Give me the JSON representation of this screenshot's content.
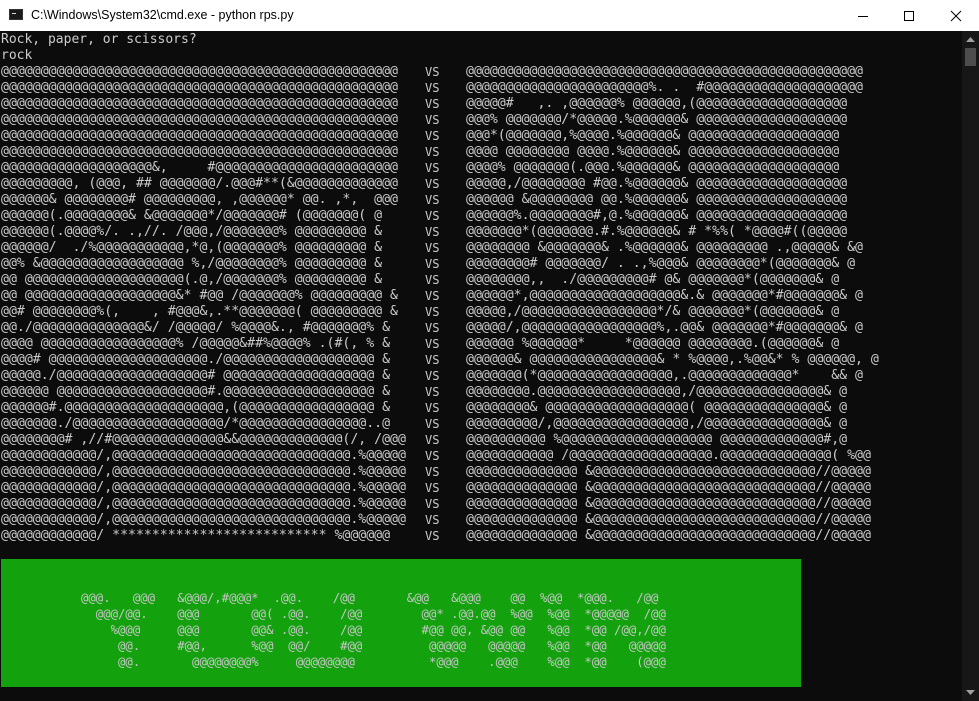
{
  "window": {
    "title": "C:\\Windows\\System32\\cmd.exe - python  rps.py",
    "app_icon": "cmd-icon",
    "controls": [
      "minimize-icon",
      "maximize-icon",
      "close-icon"
    ]
  },
  "console": {
    "prompt": "Rock, paper, or scissors?",
    "input": "rock",
    "vs_label": "VS",
    "left_art": [
      "@@@@@@@@@@@@@@@@@@@@@@@@@@@@@@@@@@@@@@@@@@@@@@@@@@",
      "@@@@@@@@@@@@@@@@@@@@@@@@@@@@@@@@@@@@@@@@@@@@@@@@@@",
      "@@@@@@@@@@@@@@@@@@@@@@@@@@@@@@@@@@@@@@@@@@@@@@@@@@",
      "@@@@@@@@@@@@@@@@@@@@@@@@@@@@@@@@@@@@@@@@@@@@@@@@@@",
      "@@@@@@@@@@@@@@@@@@@@@@@@@@@@@@@@@@@@@@@@@@@@@@@@@@",
      "@@@@@@@@@@@@@@@@@@@@@@@@@@@@@@@@@@@@@@@@@@@@@@@@@@",
      "@@@@@@@@@@@@@@@@@@@&,     #@@@@@@@@@@@@@@@@@@@@@@@",
      "@@@@@@@@@, (@@@, ## @@@@@@@/.@@@#**(&@@@@@@@@@@@@@",
      "@@@@@@& @@@@@@@@# @@@@@@@@@, ,@@@@@@* @@. ,*,  @@@",
      "@@@@@@(.@@@@@@@@& &@@@@@@@*/@@@@@@@# (@@@@@@@( @",
      "@@@@@@(.@@@@%/. .,//. /@@@,/@@@@@@@% @@@@@@@@@ &",
      "@@@@@@/  ./%@@@@@@@@@@@,*@,(@@@@@@@% @@@@@@@@@ &",
      "@@% &@@@@@@@@@@@@@@@@@@ %,/@@@@@@@@% @@@@@@@@@ &",
      "@@ @@@@@@@@@@@@@@@@@@@@(.@,/@@@@@@@% @@@@@@@@@ &",
      "@@ @@@@@@@@@@@@@@@@@@@&* #@@ /@@@@@@@% @@@@@@@@@ &",
      "@@# @@@@@@@@%(,    , #@@@&,.**@@@@@@@( @@@@@@@@@ &",
      "@@./@@@@@@@@@@@@@@&/ /@@@@@/ %@@@@&., #@@@@@@@% &",
      "@@@@ @@@@@@@@@@@@@@@@@% /@@@@@&##%@@@@% .(#(, % &",
      "@@@@# @@@@@@@@@@@@@@@@@@@@./@@@@@@@@@@@@@@@@@@@ &",
      "@@@@@./@@@@@@@@@@@@@@@@@@@# @@@@@@@@@@@@@@@@@@@ &",
      "@@@@@@ @@@@@@@@@@@@@@@@@@@#.@@@@@@@@@@@@@@@@@@@ &",
      "@@@@@@#.@@@@@@@@@@@@@@@@@@@@,(@@@@@@@@@@@@@@@@@ &",
      "@@@@@@@./@@@@@@@@@@@@@@@@@@@/*@@@@@@@@@@@@@@@@..@",
      "@@@@@@@@# ,//#@@@@@@@@@@@@@@&&@@@@@@@@@@@@@(/, /@@@",
      "@@@@@@@@@@@@/,@@@@@@@@@@@@@@@@@@@@@@@@@@@@@@.%@@@@@",
      "@@@@@@@@@@@@/,@@@@@@@@@@@@@@@@@@@@@@@@@@@@@@.%@@@@@",
      "@@@@@@@@@@@@/,@@@@@@@@@@@@@@@@@@@@@@@@@@@@@@.%@@@@@",
      "@@@@@@@@@@@@/,@@@@@@@@@@@@@@@@@@@@@@@@@@@@@@.%@@@@@",
      "@@@@@@@@@@@@/,@@@@@@@@@@@@@@@@@@@@@@@@@@@@@@.%@@@@@",
      "@@@@@@@@@@@@/ *************************** %@@@@@@"
    ],
    "right_art": [
      "@@@@@@@@@@@@@@@@@@@@@@@@@@@@@@@@@@@@@@@@@@@@@@@@@@",
      "@@@@@@@@@@@@@@@@@@@@@@@%. .  #@@@@@@@@@@@@@@@@@@@@",
      "@@@@@#   ,. ,@@@@@@% @@@@@@,(@@@@@@@@@@@@@@@@@@@",
      "@@@% @@@@@@@/*@@@@@.%@@@@@@& @@@@@@@@@@@@@@@@@@@",
      "@@@*(@@@@@@@,%@@@@.%@@@@@@& @@@@@@@@@@@@@@@@@@@",
      "@@@@ @@@@@@@@ @@@@.%@@@@@@& @@@@@@@@@@@@@@@@@@@",
      "@@@@% @@@@@@@(.@@@.%@@@@@@& @@@@@@@@@@@@@@@@@@@",
      "@@@@@,/@@@@@@@@ #@@.%@@@@@@& @@@@@@@@@@@@@@@@@@@",
      "@@@@@@ &@@@@@@@@ @@.%@@@@@@& @@@@@@@@@@@@@@@@@@@",
      "@@@@@@%.@@@@@@@@#,@.%@@@@@@& @@@@@@@@@@@@@@@@@@@",
      "@@@@@@@*(@@@@@@@.#.%@@@@@@& # *%%( *@@@@#((@@@@@",
      "@@@@@@@@ &@@@@@@@& .%@@@@@@& @@@@@@@@@ .,@@@@@& &@",
      "@@@@@@@@# @@@@@@@/ . .,%@@@& @@@@@@@@*(@@@@@@@& @",
      "@@@@@@@@,,  ./@@@@@@@@@# @& @@@@@@@*(@@@@@@@& @",
      "@@@@@@*,@@@@@@@@@@@@@@@@@@@&.& @@@@@@@*#@@@@@@@& @",
      "@@@@@,/@@@@@@@@@@@@@@@@@*/& @@@@@@@*(@@@@@@@& @",
      "@@@@@/,@@@@@@@@@@@@@@@@@%,.@@& @@@@@@@*#@@@@@@@& @",
      "@@@@@@ %@@@@@@*     *@@@@@@ @@@@@@@@.(@@@@@@& @",
      "@@@@@@& @@@@@@@@@@@@@@@@& * %@@@@,.%@@&* % @@@@@@, @",
      "@@@@@@@(*@@@@@@@@@@@@@@@@@,.@@@@@@@@@@@@@*    && @",
      "@@@@@@@@.@@@@@@@@@@@@@@@@@@,/@@@@@@@@@@@@@@@@& @",
      "@@@@@@@@& @@@@@@@@@@@@@@@@@@( @@@@@@@@@@@@@@@& @",
      "@@@@@@@@@/,@@@@@@@@@@@@@@@@@,/@@@@@@@@@@@@@@@& @",
      "@@@@@@@@@@ %@@@@@@@@@@@@@@@@@@@ @@@@@@@@@@@@@#,@",
      "@@@@@@@@@@@ /@@@@@@@@@@@@@@@@@@.@@@@@@@@@@@@@@( %@@",
      "@@@@@@@@@@@@@@ &@@@@@@@@@@@@@@@@@@@@@@@@@@@@//@@@@@",
      "@@@@@@@@@@@@@@ &@@@@@@@@@@@@@@@@@@@@@@@@@@@@//@@@@@",
      "@@@@@@@@@@@@@@ &@@@@@@@@@@@@@@@@@@@@@@@@@@@@//@@@@@",
      "@@@@@@@@@@@@@@ &@@@@@@@@@@@@@@@@@@@@@@@@@@@@//@@@@@",
      "@@@@@@@@@@@@@@ &@@@@@@@@@@@@@@@@@@@@@@@@@@@@//@@@@@"
    ],
    "banner_color": "#13a10e",
    "banner_lines": [
      "@@@.   @@@   &@@@/,#@@@*  .@@.    /@@       &@@   &@@@    @@  %@@  *@@@.   /@@",
      "  @@@/@@.    @@@       @@( .@@.    /@@        @@* .@@.@@  %@@  %@@  *@@@@@  /@@",
      "    %@@@     @@@       @@& .@@.    /@@        #@@ @@, &@@ @@   %@@  *@@ /@@,/@@",
      "     @@.     #@@,      %@@  @@/    #@@         @@@@@   @@@@@   %@@  *@@   @@@@@",
      "     @@.       @@@@@@@@%     @@@@@@@@          *@@@    .@@@    %@@  *@@    (@@@"
    ]
  }
}
